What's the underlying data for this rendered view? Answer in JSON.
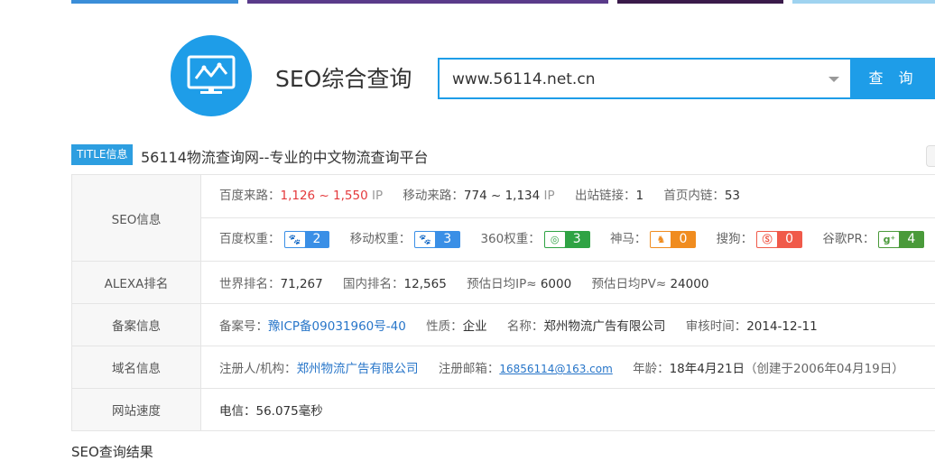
{
  "banner": {
    "colors": [
      "#3b8ed8",
      "#5a3b8a",
      "#3a1a4a",
      "#9fd3f0"
    ]
  },
  "logo": {
    "icon": "monitor-chart-icon",
    "color": "#1e9de8"
  },
  "header": {
    "title": "SEO综合查询"
  },
  "search": {
    "value": "www.56114.net.cn",
    "button_label": "查 询"
  },
  "title_info": {
    "badge": "TITLE信息",
    "text": "56114物流查询网--专业的中文物流查询平台"
  },
  "seo": {
    "label": "SEO信息",
    "baidu_traffic_label": "百度来路：",
    "baidu_traffic_value": "1,126 ~ 1,550",
    "baidu_traffic_unit": "IP",
    "mobile_traffic_label": "移动来路：",
    "mobile_traffic_value": "774 ~ 1,134",
    "mobile_traffic_unit": "IP",
    "outlinks_label": "出站链接：",
    "outlinks_value": "1",
    "inlinks_label": "首页内链：",
    "inlinks_value": "53",
    "baidu_weight_label": "百度权重：",
    "baidu_weight_value": "2",
    "mobile_weight_label": "移动权重：",
    "mobile_weight_value": "3",
    "w360_label": "360权重：",
    "w360_value": "3",
    "shenma_label": "神马：",
    "shenma_value": "0",
    "sogou_label": "搜狗：",
    "sogou_value": "0",
    "google_label": "谷歌PR：",
    "google_value": "4"
  },
  "alexa": {
    "label": "ALEXA排名",
    "world_label": "世界排名：",
    "world_value": "71,267",
    "domestic_label": "国内排名：",
    "domestic_value": "12,565",
    "ip_label": "预估日均IP≈",
    "ip_value": "6000",
    "pv_label": "预估日均PV≈",
    "pv_value": "24000"
  },
  "icp": {
    "label": "备案信息",
    "number_label": "备案号：",
    "number_value": "豫ICP备09031960号-40",
    "nature_label": "性质：",
    "nature_value": "企业",
    "name_label": "名称：",
    "name_value": "郑州物流广告有限公司",
    "review_label": "审核时间：",
    "review_value": "2014-12-11"
  },
  "domain": {
    "label": "域名信息",
    "registrant_label": "注册人/机构：",
    "registrant_value": "郑州物流广告有限公司",
    "email_label": "注册邮箱：",
    "email_value": "16856114@163.com",
    "age_label": "年龄：",
    "age_value": "18年4月21日",
    "age_note": "（创建于2006年04月19日）"
  },
  "speed": {
    "label": "网站速度",
    "value": "电信：56.075毫秒"
  },
  "results": {
    "heading": "SEO查询结果"
  }
}
